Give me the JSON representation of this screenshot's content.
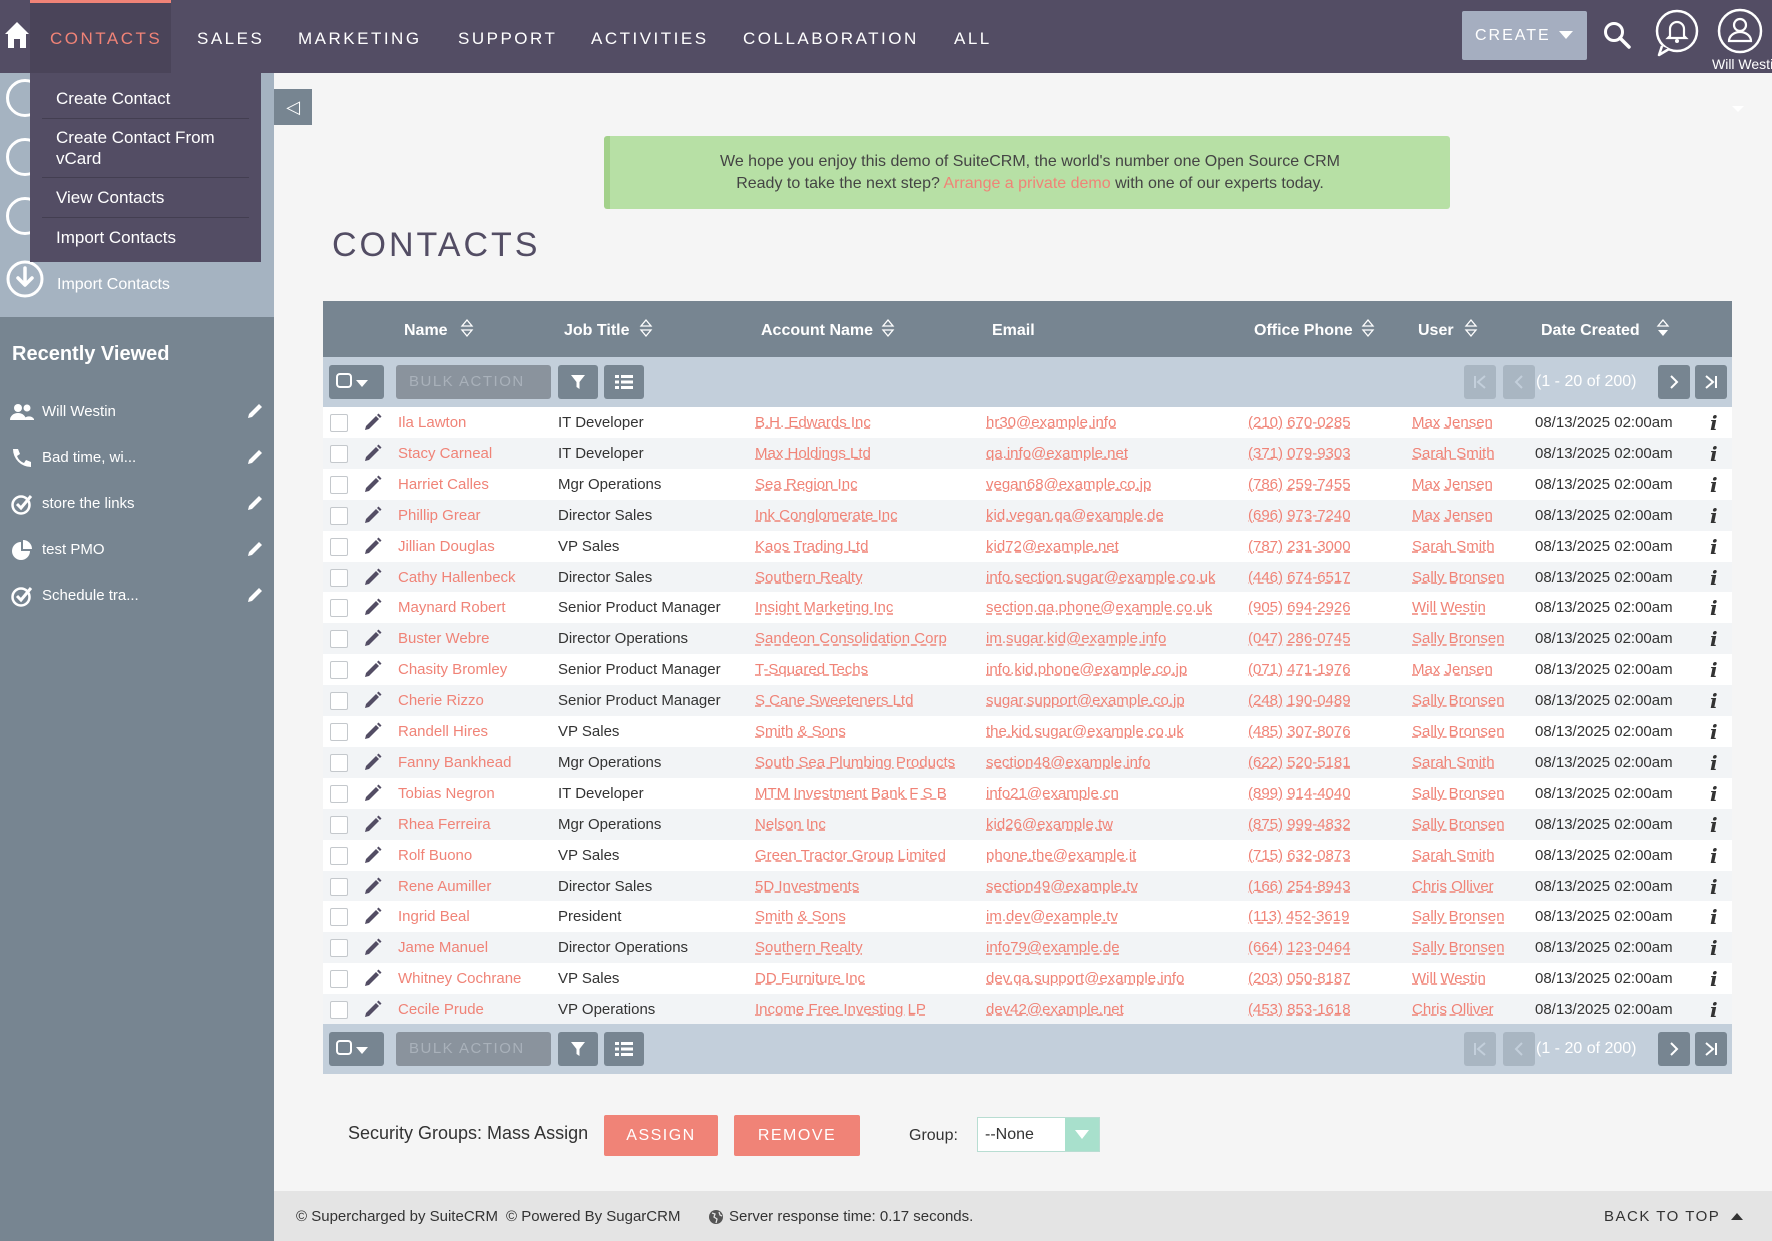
{
  "nav": {
    "items": [
      {
        "label": "CONTACTS",
        "active": true
      },
      {
        "label": "SALES"
      },
      {
        "label": "MARKETING"
      },
      {
        "label": "SUPPORT"
      },
      {
        "label": "ACTIVITIES"
      },
      {
        "label": "COLLABORATION"
      },
      {
        "label": "ALL"
      }
    ],
    "create_label": "CREATE",
    "user_name": "Will Westin"
  },
  "dropdown": {
    "items": [
      "Create Contact",
      "Create Contact From vCard",
      "View Contacts",
      "Import Contacts"
    ]
  },
  "sidebar": {
    "action_import": "Import Contacts",
    "recent_title": "Recently Viewed",
    "recent": [
      {
        "label": "Will Westin",
        "icon": "contacts-icon"
      },
      {
        "label": "Bad time, wi...",
        "icon": "phone-icon"
      },
      {
        "label": "store the links",
        "icon": "task-icon"
      },
      {
        "label": "test PMO",
        "icon": "pie-chart-icon"
      },
      {
        "label": "Schedule tra...",
        "icon": "task-icon"
      }
    ]
  },
  "banner": {
    "line1": "We hope you enjoy this demo of SuiteCRM, the world's number one Open Source CRM",
    "line2_pre": "Ready to take the next step?",
    "line2_link": "Arrange a private demo",
    "line2_post": "with one of our experts today."
  },
  "page_title": "CONTACTS",
  "table": {
    "columns": {
      "name": "Name",
      "job": "Job Title",
      "account": "Account Name",
      "email": "Email",
      "phone": "Office Phone",
      "user": "User",
      "date": "Date Created"
    },
    "bulk_action": "BULK ACTION",
    "pagination": "(1 - 20 of 200)",
    "rows": [
      {
        "name": "Ila Lawton",
        "job": "IT Developer",
        "account": "B.H. Edwards Inc",
        "email": "hr30@example.info",
        "phone": "(210) 670-0285",
        "user": "Max Jensen",
        "date": "08/13/2025 02:00am"
      },
      {
        "name": "Stacy Carneal",
        "job": "IT Developer",
        "account": "Max Holdings Ltd",
        "email": "qa.info@example.net",
        "phone": "(371) 079-9303",
        "user": "Sarah Smith",
        "date": "08/13/2025 02:00am"
      },
      {
        "name": "Harriet Calles",
        "job": "Mgr Operations",
        "account": "Sea Region Inc",
        "email": "vegan68@example.co.jp",
        "phone": "(786) 259-7455",
        "user": "Max Jensen",
        "date": "08/13/2025 02:00am"
      },
      {
        "name": "Phillip Grear",
        "job": "Director Sales",
        "account": "Ink Conglomerate Inc",
        "email": "kid.vegan.qa@example.de",
        "phone": "(696) 973-7240",
        "user": "Max Jensen",
        "date": "08/13/2025 02:00am"
      },
      {
        "name": "Jillian Douglas",
        "job": "VP Sales",
        "account": "Kaos Trading Ltd",
        "email": "kid72@example.net",
        "phone": "(787) 231-3000",
        "user": "Sarah Smith",
        "date": "08/13/2025 02:00am"
      },
      {
        "name": "Cathy Hallenbeck",
        "job": "Director Sales",
        "account": "Southern Realty",
        "email": "info.section.sugar@example.co.uk",
        "phone": "(446) 674-6517",
        "user": "Sally Bronsen",
        "date": "08/13/2025 02:00am"
      },
      {
        "name": "Maynard Robert",
        "job": "Senior Product Manager",
        "account": "Insight Marketing Inc",
        "email": "section.qa.phone@example.co.uk",
        "phone": "(905) 694-2926",
        "user": "Will Westin",
        "date": "08/13/2025 02:00am"
      },
      {
        "name": "Buster Webre",
        "job": "Director Operations",
        "account": "Sandeon Consolidation Corp",
        "email": "im.sugar.kid@example.info",
        "phone": "(047) 286-0745",
        "user": "Sally Bronsen",
        "date": "08/13/2025 02:00am"
      },
      {
        "name": "Chasity Bromley",
        "job": "Senior Product Manager",
        "account": "T-Squared Techs",
        "email": "info.kid.phone@example.co.jp",
        "phone": "(071) 471-1976",
        "user": "Max Jensen",
        "date": "08/13/2025 02:00am"
      },
      {
        "name": "Cherie Rizzo",
        "job": "Senior Product Manager",
        "account": "S Cane Sweeteners Ltd",
        "email": "sugar.support@example.co.jp",
        "phone": "(248) 190-0489",
        "user": "Sally Bronsen",
        "date": "08/13/2025 02:00am"
      },
      {
        "name": "Randell Hires",
        "job": "VP Sales",
        "account": "Smith & Sons",
        "email": "the.kid.sugar@example.co.uk",
        "phone": "(485) 307-8076",
        "user": "Sally Bronsen",
        "date": "08/13/2025 02:00am"
      },
      {
        "name": "Fanny Bankhead",
        "job": "Mgr Operations",
        "account": "South Sea Plumbing Products",
        "email": "section48@example.info",
        "phone": "(622) 520-5181",
        "user": "Sarah Smith",
        "date": "08/13/2025 02:00am"
      },
      {
        "name": "Tobias Negron",
        "job": "IT Developer",
        "account": "MTM Investment Bank F S B",
        "email": "info21@example.cn",
        "phone": "(899) 914-4040",
        "user": "Sally Bronsen",
        "date": "08/13/2025 02:00am"
      },
      {
        "name": "Rhea Ferreira",
        "job": "Mgr Operations",
        "account": "Nelson Inc",
        "email": "kid26@example.tw",
        "phone": "(875) 999-4832",
        "user": "Sally Bronsen",
        "date": "08/13/2025 02:00am"
      },
      {
        "name": "Rolf Buono",
        "job": "VP Sales",
        "account": "Green Tractor Group Limited",
        "email": "phone.the@example.it",
        "phone": "(715) 632-0873",
        "user": "Sarah Smith",
        "date": "08/13/2025 02:00am"
      },
      {
        "name": "Rene Aumiller",
        "job": "Director Sales",
        "account": "5D Investments",
        "email": "section49@example.tv",
        "phone": "(166) 254-8943",
        "user": "Chris Olliver",
        "date": "08/13/2025 02:00am"
      },
      {
        "name": "Ingrid Beal",
        "job": "President",
        "account": "Smith & Sons",
        "email": "im.dev@example.tv",
        "phone": "(113) 452-3619",
        "user": "Sally Bronsen",
        "date": "08/13/2025 02:00am"
      },
      {
        "name": "Jame Manuel",
        "job": "Director Operations",
        "account": "Southern Realty",
        "email": "info79@example.de",
        "phone": "(664) 123-0464",
        "user": "Sally Bronsen",
        "date": "08/13/2025 02:00am"
      },
      {
        "name": "Whitney Cochrane",
        "job": "VP Sales",
        "account": "DD Furniture Inc",
        "email": "dev.qa.support@example.info",
        "phone": "(203) 050-8187",
        "user": "Will Westin",
        "date": "08/13/2025 02:00am"
      },
      {
        "name": "Cecile Prude",
        "job": "VP Operations",
        "account": "Income Free Investing LP",
        "email": "dev42@example.net",
        "phone": "(453) 853-1618",
        "user": "Chris Olliver",
        "date": "08/13/2025 02:00am"
      }
    ]
  },
  "mass_assign": {
    "label": "Security Groups: Mass Assign",
    "assign": "ASSIGN",
    "remove": "REMOVE",
    "group_label": "Group:",
    "group_value": "--None"
  },
  "footer": {
    "suitecrm": "© Supercharged by SuiteCRM",
    "sugarcrm": "© Powered By SugarCRM",
    "response": "Server response time: 0.17 seconds.",
    "back_to_top": "BACK TO TOP"
  },
  "colors": {
    "nav_bg": "#534d64",
    "accent": "#f08377",
    "sidebar_bg": "#778591",
    "banner_bg": "#b7e0a5"
  }
}
